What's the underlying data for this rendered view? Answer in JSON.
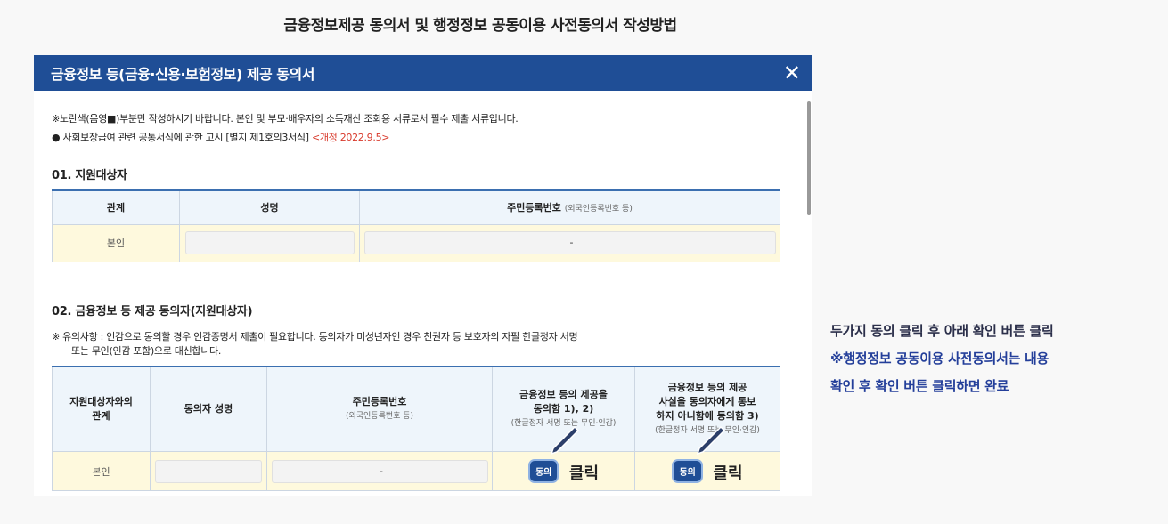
{
  "page": {
    "heading": "금융정보제공 동의서 및 행정정보 공동이용 사전동의서 작성방법"
  },
  "modal": {
    "title": "금융정보 등(금융·신용·보험정보) 제공 동의서",
    "close_label": "✕",
    "notice1": "※노란색(음영■)부분만 작성하시기 바랍니다. 본인 및 부모·배우자의 소득재산 조회용 서류로서 필수 제출 서류입니다.",
    "notice2": "● 사회보장급여 관련 공통서식에 관한 고시 [별지 제1호의3서식]",
    "revision": "<개정 2022.9.5>"
  },
  "section1": {
    "title": "01. 지원대상자",
    "headers": {
      "relation": "관계",
      "name": "성명",
      "rrn": "주민등록번호",
      "rrn_sub": "(외국인등록번호 등)"
    },
    "row": {
      "relation": "본인",
      "rrn_dash": "-"
    }
  },
  "section2": {
    "title": "02. 금융정보 등 제공 동의자(지원대상자)",
    "note_line1": "※ 유의사항 : 인감으로 동의할 경우 인감증명서 제출이 필요합니다. 동의자가 미성년자인 경우 친권자 등 보호자의 자필 한글정자 서명",
    "note_line2": "또는 무인(인감 포함)으로 대신합니다.",
    "headers": {
      "relation_line1": "지원대상자와의",
      "relation_line2": "관계",
      "name": "동의자 성명",
      "rrn": "주민등록번호",
      "rrn_sub": "(외국인등록번호 등)",
      "consent1_line1": "금융정보 등의 제공을",
      "consent1_line2": "동의함 1), 2)",
      "consent1_sub": "(한글정자 서명 또는 무인·인감)",
      "consent2_line1": "금융정보 등의 제공",
      "consent2_line2": "사실을 동의자에게 통보",
      "consent2_line3": "하지 아니함에 동의함 3)",
      "consent2_sub": "(한글정자 서명 또는 무인·인감)"
    },
    "row": {
      "relation": "본인",
      "rrn_dash": "-",
      "agree_label": "동의",
      "click_label": "클릭"
    }
  },
  "side_instructions": {
    "line1": "두가지 동의 클릭 후 아래 확인 버튼 클릭",
    "line2": "※행정정보 공동이용 사전동의서는 내용",
    "line3": "확인 후 확인 버튼 클릭하면 완료"
  },
  "colors": {
    "header_blue": "#1f4e96",
    "row_yellow": "#fef9dd",
    "header_bg": "#eef5fb",
    "revision_red": "#d8392b",
    "side_blue": "#243f9a"
  }
}
